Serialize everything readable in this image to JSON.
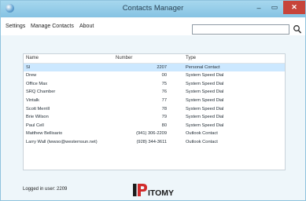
{
  "window": {
    "title": "Contacts Manager",
    "min_glyph": "–",
    "max_glyph": "▭",
    "close_glyph": "✕"
  },
  "menu": {
    "settings": "Settings",
    "manage": "Manage Contacts",
    "about": "About"
  },
  "search": {
    "value": "",
    "placeholder": ""
  },
  "table": {
    "headers": {
      "name": "Name",
      "number": "Number",
      "type": "Type"
    },
    "rows": [
      {
        "name": "SI",
        "number": "2207",
        "type": "Personal Contact",
        "selected": true
      },
      {
        "name": "Drew",
        "number": "00",
        "type": "System Speed Dial"
      },
      {
        "name": "Office Max",
        "number": "75",
        "type": "System Speed Dial"
      },
      {
        "name": "SRQ Chamber",
        "number": "76",
        "type": "System Speed Dial"
      },
      {
        "name": "Vintalk",
        "number": "77",
        "type": "System Speed Dial"
      },
      {
        "name": "Scott Merrill",
        "number": "78",
        "type": "System Speed Dial"
      },
      {
        "name": "Brie Wilson",
        "number": "79",
        "type": "System Speed Dial"
      },
      {
        "name": "Paul Cell",
        "number": "80",
        "type": "System Speed Dial"
      },
      {
        "name": "Matthew Bellisario",
        "number": "(941) 306-2209",
        "type": "Outlook Contact"
      },
      {
        "name": "Larry Wall (lwwso@westernsun.net)",
        "number": "(928) 344-3611",
        "type": "Outlook Contact"
      }
    ]
  },
  "status": {
    "logged_in": "Logged in user: 2209"
  },
  "logo": {
    "brand": "IPITOMY"
  },
  "colors": {
    "titlebar": "#8fcbe6",
    "selected_row": "#cce8ff",
    "close_button": "#c7443a",
    "logo_dark": "#1a1a1a",
    "logo_red": "#d12c2c"
  }
}
